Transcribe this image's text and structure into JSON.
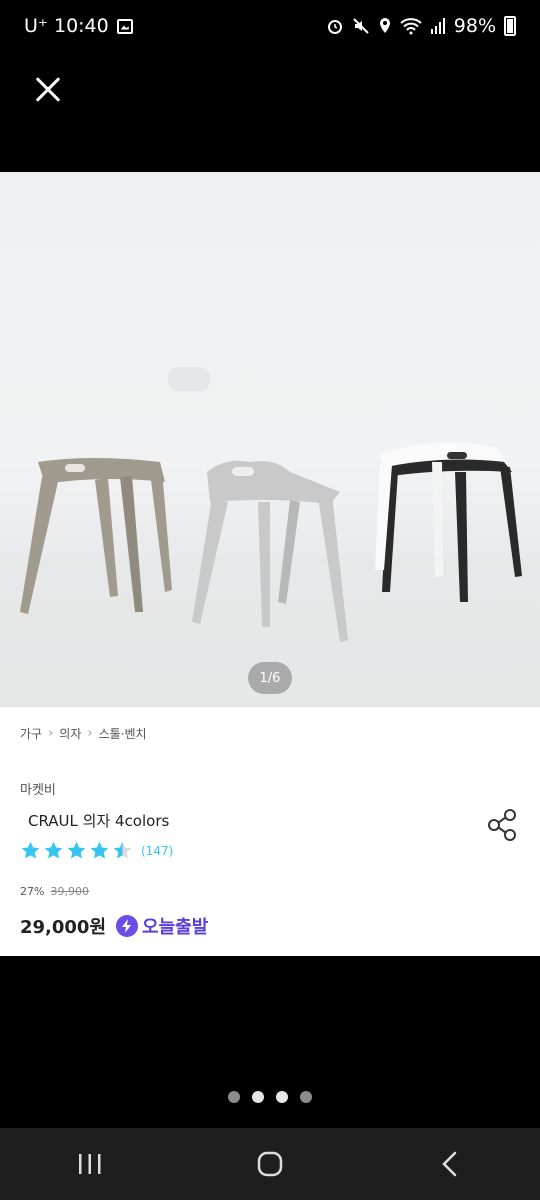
{
  "status": {
    "carrier": "U⁺ 10:40",
    "battery": "98%",
    "icons": [
      "image-icon",
      "alarm-icon",
      "mute-icon",
      "location-icon",
      "wifi-icon",
      "signal-icon",
      "battery-icon"
    ]
  },
  "gallery": {
    "page_indicator": "1/6",
    "dots_count": 4,
    "active_dot": 0
  },
  "breadcrumb": [
    "가구",
    "의자",
    "스툴·벤치"
  ],
  "product": {
    "brand": "마켓비",
    "name": "CRAUL 의자 4colors",
    "rating_value": 4.5,
    "review_count": "(147)",
    "discount": "27%",
    "original_price": "39,900",
    "price": "29,000원",
    "delivery_badge": "오늘출발"
  },
  "colors": {
    "star": "#35c5f0",
    "badge": "#5b3fd9",
    "background": "#000000"
  },
  "navbar": {
    "icons": [
      "recent-apps-icon",
      "home-icon",
      "back-icon"
    ]
  }
}
